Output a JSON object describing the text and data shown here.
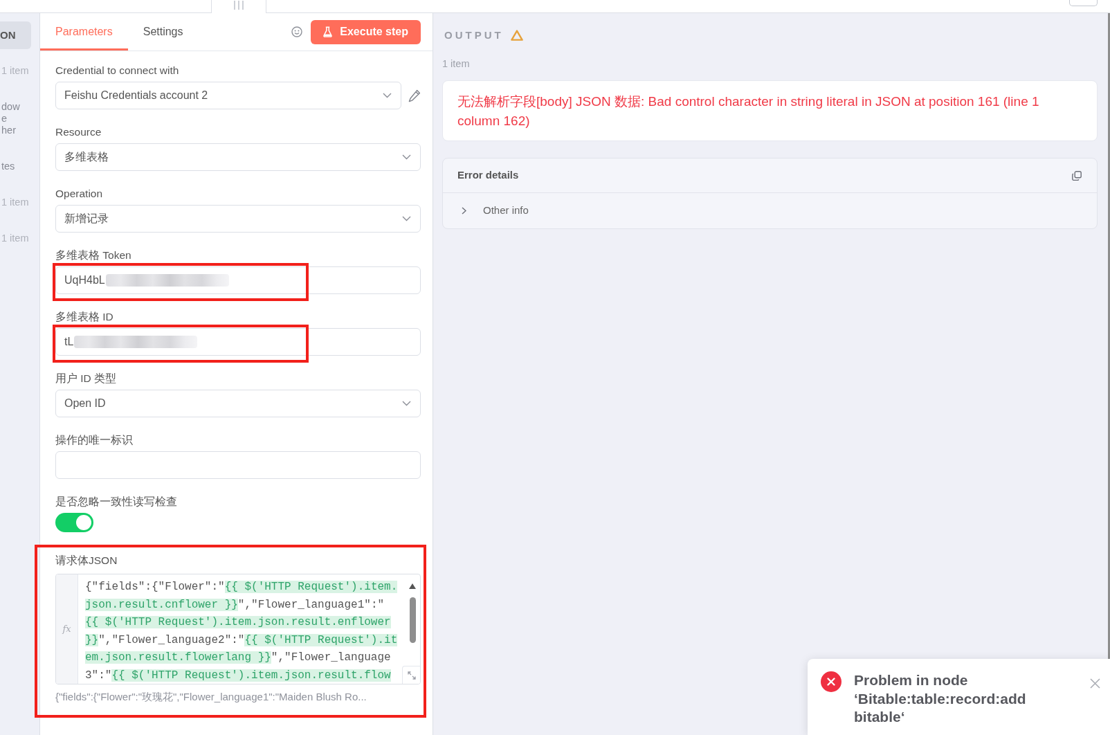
{
  "input_panel": {
    "view_button": "ON",
    "entries": [
      {
        "kind": "count",
        "lines": [
          "1 item"
        ]
      },
      {
        "kind": "name",
        "lines": [
          "dow",
          "e",
          "her"
        ]
      },
      {
        "kind": "name",
        "lines": [
          "tes"
        ]
      },
      {
        "kind": "count",
        "lines": [
          "1 item"
        ]
      },
      {
        "kind": "count",
        "lines": [
          "1 item"
        ]
      }
    ]
  },
  "node_panel": {
    "tabs": [
      {
        "label": "Parameters",
        "selected": true
      },
      {
        "label": "Settings",
        "selected": false
      }
    ],
    "execute_button": "Execute step",
    "fields": [
      {
        "kind": "credential",
        "label": "Credential to connect with",
        "value": "Feishu Credentials account 2",
        "highlighted": false
      },
      {
        "kind": "select",
        "label": "Resource",
        "value": "多维表格",
        "highlighted": false
      },
      {
        "kind": "select",
        "label": "Operation",
        "value": "新增记录",
        "highlighted": false
      },
      {
        "kind": "text",
        "label": "多维表格 Token",
        "value": "UqH4bL",
        "redacted": true,
        "highlighted": true
      },
      {
        "kind": "text",
        "label": "多维表格 ID",
        "value": "tL",
        "redacted": true,
        "highlighted": true
      },
      {
        "kind": "select",
        "label": "用户 ID 类型",
        "value": "Open ID",
        "highlighted": false
      },
      {
        "kind": "text",
        "label": "操作的唯一标识",
        "redacted": false,
        "highlighted": false
      },
      {
        "kind": "toggle",
        "label": "是否忽略一致性读写检查",
        "on": true,
        "highlighted": false
      },
      {
        "kind": "code",
        "label": "请求体JSON",
        "gutter": "fx",
        "highlighted": true,
        "lines": [
          [
            {
              "kind": "plain",
              "text": "{\"fields\":{\"Flower\":\""
            },
            {
              "kind": "expression",
              "text": "{{ $('HTTP Request').item."
            }
          ],
          [
            {
              "kind": "expression",
              "text": "json.result.cnflower }}"
            },
            {
              "kind": "plain",
              "text": "\",\"Flower_language1\":\""
            }
          ],
          [
            {
              "kind": "expression",
              "text": "{{ $('HTTP Request').item.json.result.enflower"
            }
          ],
          [
            {
              "kind": "expression",
              "text": "}}"
            },
            {
              "kind": "plain",
              "text": "\",\"Flower_language2\":\""
            },
            {
              "kind": "expression",
              "text": "{{ $('HTTP Request').it"
            }
          ],
          [
            {
              "kind": "expression",
              "text": "em.json.result.flowerlang }}"
            },
            {
              "kind": "plain",
              "text": "\",\"Flower_language"
            }
          ],
          [
            {
              "kind": "plain",
              "text": "3\":\""
            },
            {
              "kind": "expression",
              "text": "{{ $('HTTP Request').item.json.result.flow"
            }
          ]
        ],
        "preview": "{\"fields\":{\"Flower\":\"玫瑰花\",\"Flower_language1\":\"Maiden Blush Ro..."
      }
    ]
  },
  "output_panel": {
    "title": "OUTPUT",
    "warning": true,
    "item_count": "1 item",
    "error_message": "无法解析字段[body] JSON 数据: Bad control character in string literal in JSON at position 161 (line 1 column 162)",
    "error_details": {
      "title": "Error details",
      "sections": [
        {
          "label": "Other info",
          "expanded": false
        }
      ]
    }
  },
  "notification": {
    "kind": "error",
    "title": "Problem in node ‘Bitable:table:record:add bitable‘"
  }
}
